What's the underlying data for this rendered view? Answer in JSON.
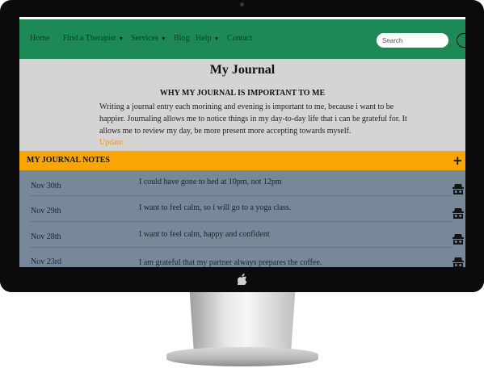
{
  "nav": {
    "items": [
      {
        "label": "Home",
        "has_dropdown": false
      },
      {
        "label": "Find a Therapist",
        "has_dropdown": true
      },
      {
        "label": "Services",
        "has_dropdown": true
      },
      {
        "label": "Blog",
        "has_dropdown": false
      },
      {
        "label": "Help",
        "has_dropdown": true
      },
      {
        "label": "Contact",
        "has_dropdown": false
      }
    ],
    "search_placeholder": "Search"
  },
  "page": {
    "title": "My Journal",
    "subheading": "WHY MY JOURNAL IS IMPORTANT TO ME",
    "body": "Writing a journal entry each morining and evening is important to me, because i want to be happier. Journaling allows me to notice things in my day-to-day life that i can be grateful for. It allows me to review my day, be more present more accepting towards myself.",
    "update_link": "Update"
  },
  "notes": {
    "header": "MY JOURNAL NOTES",
    "add_icon": "plus-icon",
    "row_icon": "incognito-icon",
    "entries": [
      {
        "date": "Nov 30th",
        "text": "I could have gone to bed at 10pm, not 12pm"
      },
      {
        "date": "Nov 29th",
        "text": "I want to feel calm, so i will go to a yoga class."
      },
      {
        "date": "Nov 28th",
        "text": "I want to feel calm, happy and confident"
      },
      {
        "date": "Nov 23rd",
        "text": "I am grateful that my partner always prepares the coffee."
      }
    ]
  },
  "colors": {
    "navbar": "#1d8a56",
    "notes_header": "#f8a606",
    "notes_list": "#778899",
    "page_background": "#d4d4d4",
    "link": "#f0941c"
  }
}
